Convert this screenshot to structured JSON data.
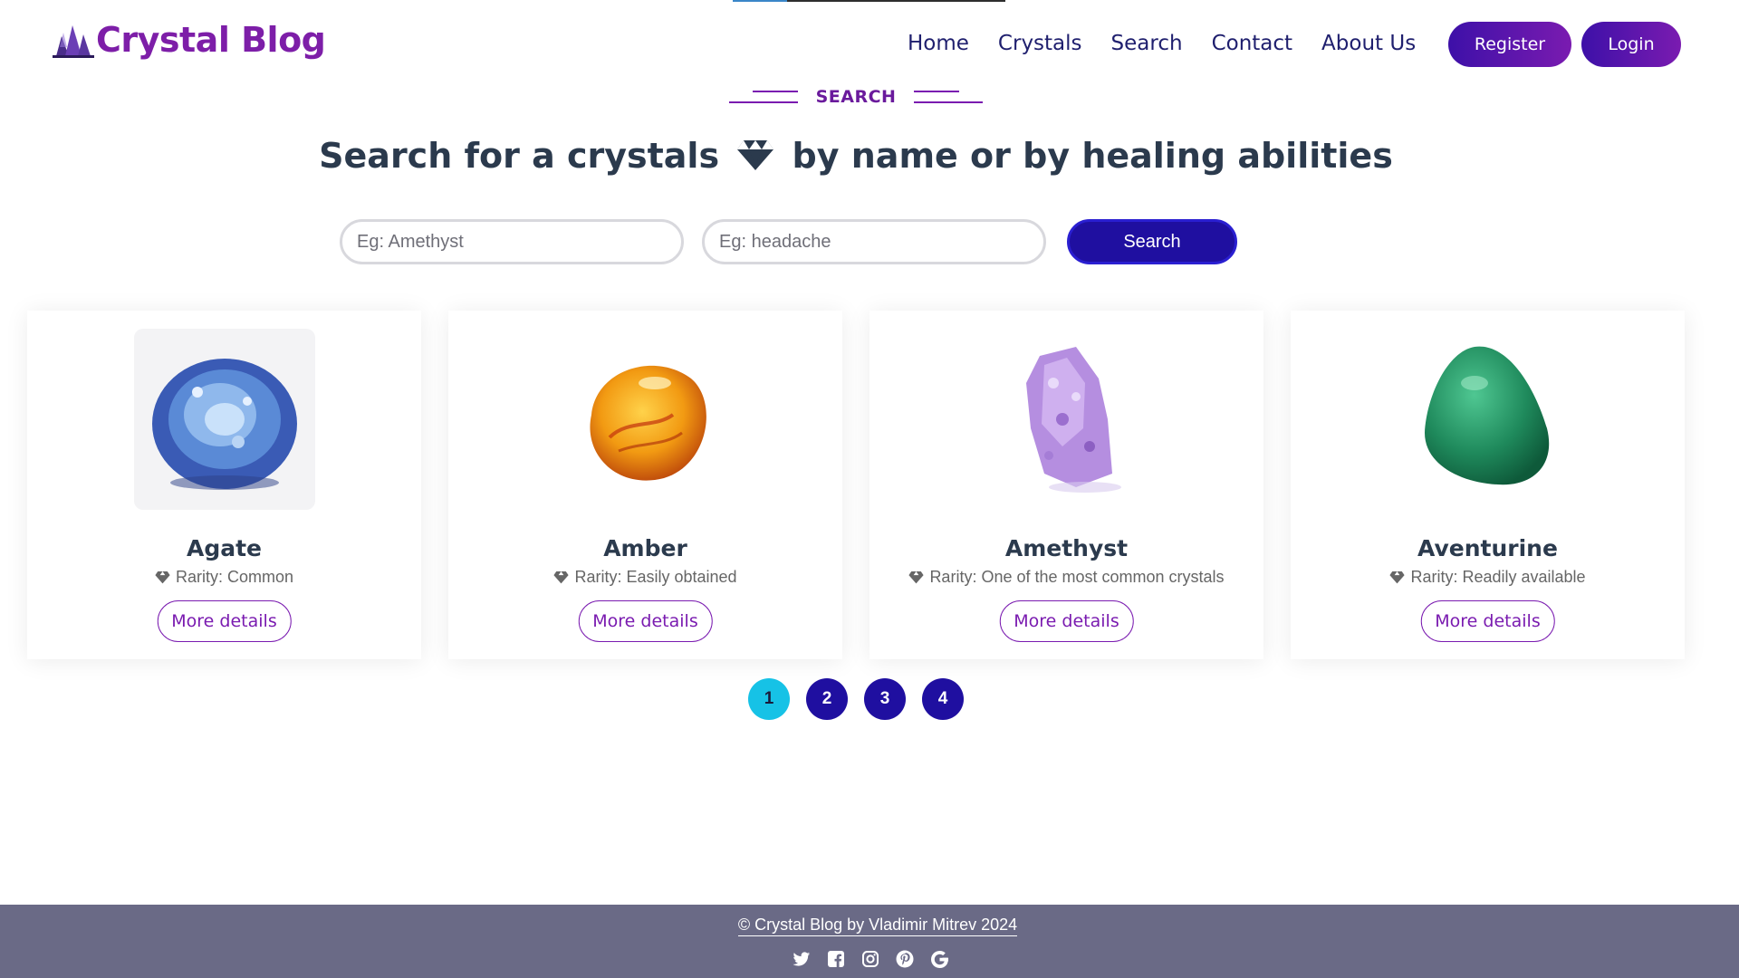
{
  "header": {
    "logo_text": "Crystal Blog",
    "nav": [
      "Home",
      "Crystals",
      "Search",
      "Contact",
      "About Us"
    ],
    "register_label": "Register",
    "login_label": "Login"
  },
  "section": {
    "label": "SEARCH",
    "headline_part1": "Search for a crystals",
    "headline_part2": "by name or by healing abilities"
  },
  "search": {
    "name_placeholder": "Eg: Amethyst",
    "ability_placeholder": "Eg: headache",
    "button_label": "Search"
  },
  "cards": [
    {
      "name": "Agate",
      "rarity": "Rarity: Common",
      "button": "More details",
      "image": "agate-crystal"
    },
    {
      "name": "Amber",
      "rarity": "Rarity: Easily obtained",
      "button": "More details",
      "image": "amber-stone"
    },
    {
      "name": "Amethyst",
      "rarity": "Rarity: One of the most common crystals",
      "button": "More details",
      "image": "amethyst-cluster"
    },
    {
      "name": "Aventurine",
      "rarity": "Rarity: Readily available",
      "button": "More details",
      "image": "aventurine-stone"
    }
  ],
  "pagination": {
    "pages": [
      "1",
      "2",
      "3",
      "4"
    ],
    "active": "1"
  },
  "footer": {
    "copyright": "© Crystal Blog by Vladimir Mitrev 2024",
    "socials": [
      "twitter-icon",
      "facebook-icon",
      "instagram-icon",
      "pinterest-icon",
      "google-icon"
    ]
  },
  "colors": {
    "brand_purple": "#7d1ea8",
    "nav_text": "#1f1f6e",
    "search_button": "#1f0fa0",
    "active_page": "#16c2e6",
    "footer_bg": "#6a6a86"
  }
}
